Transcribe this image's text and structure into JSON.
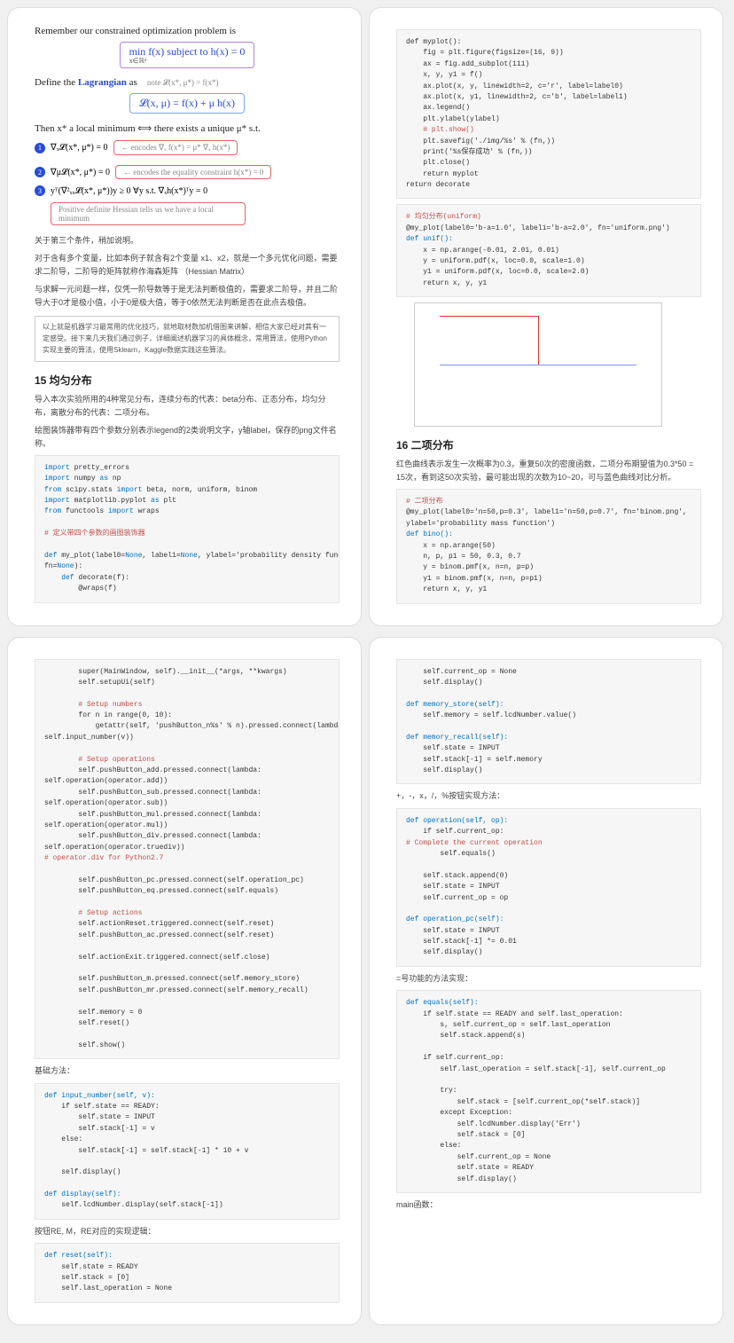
{
  "page1": {
    "intro": "Remember our constrained optimization problem is",
    "formula1": "min f(x)  subject to  h(x) = 0",
    "sub1": "x∈ℝᵈ",
    "def_line_a": "Define the ",
    "def_line_b": "Lagrangian",
    "def_line_c": " as",
    "def_note": "note  𝓛(x*, μ*) = f(x*)",
    "formula2": "𝓛(x, μ) = f(x) + μ h(x)",
    "then_a": "Then x* a local minimum  ⟺  there exists a unique μ* s.t.",
    "b1_eq": "∇ₓ𝓛(x*, μ*) = 0",
    "b1_box": "← encodes ∇ₓ f(x*) = μ* ∇ₓ h(x*)",
    "b2_eq": "∇μ𝓛(x*, μ*) = 0",
    "b2_box": "← encodes the equality constraint h(x*) = 0",
    "b3_eq": "yᵀ(∇²ₓₓ𝓛(x*, μ*))y ≥ 0   ∀y s.t. ∇ₓh(x*)ᵀy = 0",
    "b3_box": "Positive definite Hessian tells us we have a local minimum",
    "p_after1": "关于第三个条件，稍加说明。",
    "p_after2": "对于含有多个变量，比如本例子就含有2个变量 x1、x2，就是一个多元优化问题，需要求二阶导，二阶导的矩阵就称作海森矩阵 （Hessian Matrix）",
    "p_after3": "与求解一元问题一样，仅凭一阶导数等于是无法判断极值的，需要求二阶导，并且二阶导大于0才是极小值，小于0是极大值，等于0依然无法判断是否在此点去极值。",
    "bx1": "以上就是机器学习最常用的优化技巧，就地取材数加机借图来讲解，相信大家已经对其有一定感受。接下来几天我们通过例子，详细阐述机器学习的具体概念，常用算法，使用Python实现主要的算法，使用Sklearn，Kaggle数据实践这些算法。",
    "h15": "15 均匀分布",
    "p15a": "导入本次实验所用的4种常见分布，连续分布的代表：beta分布、正态分布，均匀分布，离散分布的代表：二项分布。",
    "p15b": "绘图装饰器带有四个参数分别表示legend的2类说明文字，y轴label，保存的png文件名称。",
    "code1": "import pretty_errors\nimport numpy as np\nfrom scipy.stats import beta, norm, uniform, binom\nimport matplotlib.pyplot as plt\nfrom functools import wraps\n\n# 定义带四个参数的画图装饰器\n\ndef my_plot(label0=None, label1=None, ylabel='probability density function',\nfn=None):\n    def decorate(f):\n        @wraps(f)"
  },
  "page2": {
    "code2_lines": [
      [
        "",
        "def myplot():"
      ],
      [
        "",
        "    fig = plt.figure(figsize=(16, 9))"
      ],
      [
        "",
        "    ax = fig.add_subplot(111)"
      ],
      [
        "",
        "    x, y, y1 = f()"
      ],
      [
        "",
        "    ax.plot(x, y, linewidth=2, c='r', label=label0)"
      ],
      [
        "",
        "    ax.plot(x, y1, linewidth=2, c='b', label=label1)"
      ],
      [
        "",
        "    ax.legend()"
      ],
      [
        "",
        "    plt.ylabel(ylabel)"
      ],
      [
        "cmt",
        "    # plt.show()"
      ],
      [
        "",
        "    plt.savefig('./img/%s' % (fn,))"
      ],
      [
        "",
        "    print('%s保存成功' % (fn,))"
      ],
      [
        "",
        "    plt.close()"
      ],
      [
        "",
        "    return myplot"
      ],
      [
        "",
        "return decorate"
      ]
    ],
    "code3_lines": [
      [
        "cmt",
        "# 均匀分布(uniform)"
      ],
      [
        "",
        "@my_plot(label0='b-a=1.0', label1='b-a=2.0', fn='uniform.png')"
      ],
      [
        "fdef",
        "def unif():"
      ],
      [
        "",
        "    x = np.arange(-0.01, 2.01, 0.01)"
      ],
      [
        "",
        "    y = uniform.pdf(x, loc=0.0, scale=1.0)"
      ],
      [
        "",
        "    y1 = uniform.pdf(x, loc=0.0, scale=2.0)"
      ],
      [
        "",
        "    return x, y, y1"
      ]
    ],
    "h16": "16 二项分布",
    "p16": "红色曲线表示发生一次概率为0.3，重复50次的密度函数，二项分布期望值为0.3*50 = 15次，看到这50次实验，最可能出现的次数为10~20，可与蓝色曲线对比分析。",
    "code4_lines": [
      [
        "cmt",
        "# 二项分布"
      ],
      [
        "",
        "@my_plot(label0='n=50,p=0.3', label1='n=50,p=0.7', fn='binom.png',"
      ],
      [
        "",
        "ylabel='probability mass function')"
      ],
      [
        "fdef",
        "def bino():"
      ],
      [
        "",
        "    x = np.arange(50)"
      ],
      [
        "",
        "    n, p, p1 = 50, 0.3, 0.7"
      ],
      [
        "",
        "    y = binom.pmf(x, n=n, p=p)"
      ],
      [
        "",
        "    y1 = binom.pmf(x, n=n, p=p1)"
      ],
      [
        "",
        "    return x, y, y1"
      ]
    ]
  },
  "page3": {
    "code5_lines": [
      [
        "",
        "        super(MainWindow, self).__init__(*args, **kwargs)"
      ],
      [
        "",
        "        self.setupUi(self)"
      ],
      [
        "",
        ""
      ],
      [
        "cmt",
        "        # Setup numbers"
      ],
      [
        "",
        "        for n in range(0, 10):"
      ],
      [
        "",
        "            getattr(self, 'pushButton_n%s' % n).pressed.connect(lambda v=n:"
      ],
      [
        "",
        "self.input_number(v))"
      ],
      [
        "",
        ""
      ],
      [
        "cmt",
        "        # Setup operations"
      ],
      [
        "",
        "        self.pushButton_add.pressed.connect(lambda:"
      ],
      [
        "",
        "self.operation(operator.add))"
      ],
      [
        "",
        "        self.pushButton_sub.pressed.connect(lambda:"
      ],
      [
        "",
        "self.operation(operator.sub))"
      ],
      [
        "",
        "        self.pushButton_mul.pressed.connect(lambda:"
      ],
      [
        "",
        "self.operation(operator.mul))"
      ],
      [
        "",
        "        self.pushButton_div.pressed.connect(lambda:"
      ],
      [
        "",
        "self.operation(operator.truediv))  "
      ],
      [
        "cmt",
        "# operator.div for Python2.7"
      ],
      [
        "",
        ""
      ],
      [
        "",
        "        self.pushButton_pc.pressed.connect(self.operation_pc)"
      ],
      [
        "",
        "        self.pushButton_eq.pressed.connect(self.equals)"
      ],
      [
        "",
        ""
      ],
      [
        "cmt",
        "        # Setup actions"
      ],
      [
        "",
        "        self.actionReset.triggered.connect(self.reset)"
      ],
      [
        "",
        "        self.pushButton_ac.pressed.connect(self.reset)"
      ],
      [
        "",
        ""
      ],
      [
        "",
        "        self.actionExit.triggered.connect(self.close)"
      ],
      [
        "",
        ""
      ],
      [
        "",
        "        self.pushButton_m.pressed.connect(self.memory_store)"
      ],
      [
        "",
        "        self.pushButton_mr.pressed.connect(self.memory_recall)"
      ],
      [
        "",
        ""
      ],
      [
        "",
        "        self.memory = 0"
      ],
      [
        "",
        "        self.reset()"
      ],
      [
        "",
        ""
      ],
      [
        "",
        "        self.show()"
      ]
    ],
    "p_basic": "基础方法：",
    "code6_lines": [
      [
        "fdef",
        "def input_number(self, v):"
      ],
      [
        "",
        "    if self.state == READY:"
      ],
      [
        "",
        "        self.state = INPUT"
      ],
      [
        "",
        "        self.stack[-1] = v"
      ],
      [
        "",
        "    else:"
      ],
      [
        "",
        "        self.stack[-1] = self.stack[-1] * 10 + v"
      ],
      [
        "",
        ""
      ],
      [
        "",
        "    self.display()"
      ],
      [
        "",
        ""
      ],
      [
        "fdef",
        "def display(self):"
      ],
      [
        "",
        "    self.lcdNumber.display(self.stack[-1])"
      ]
    ],
    "p_rem": "按钮RE, M，RE对应的实现逻辑：",
    "code7_lines": [
      [
        "fdef",
        "def reset(self):"
      ],
      [
        "",
        "    self.state = READY"
      ],
      [
        "",
        "    self.stack = [0]"
      ],
      [
        "",
        "    self.last_operation = None"
      ]
    ]
  },
  "page4": {
    "code8_lines": [
      [
        "",
        "    self.current_op = None"
      ],
      [
        "",
        "    self.display()"
      ],
      [
        "",
        ""
      ],
      [
        "fdef",
        "def memory_store(self):"
      ],
      [
        "",
        "    self.memory = self.lcdNumber.value()"
      ],
      [
        "",
        ""
      ],
      [
        "fdef",
        "def memory_recall(self):"
      ],
      [
        "",
        "    self.state = INPUT"
      ],
      [
        "",
        "    self.stack[-1] = self.memory"
      ],
      [
        "",
        "    self.display()"
      ]
    ],
    "p_ops": "+，-，x，/，%按钮实现方法：",
    "code9_lines": [
      [
        "fdef",
        "def operation(self, op):"
      ],
      [
        "",
        "    if self.current_op:  "
      ],
      [
        "cmt",
        "# Complete the current operation"
      ],
      [
        "",
        "        self.equals()"
      ],
      [
        "",
        ""
      ],
      [
        "",
        "    self.stack.append(0)"
      ],
      [
        "",
        "    self.state = INPUT"
      ],
      [
        "",
        "    self.current_op = op"
      ],
      [
        "",
        ""
      ],
      [
        "fdef",
        "def operation_pc(self):"
      ],
      [
        "",
        "    self.state = INPUT"
      ],
      [
        "",
        "    self.stack[-1] *= 0.01"
      ],
      [
        "",
        "    self.display()"
      ]
    ],
    "p_eq": "=号功能的方法实现：",
    "code10_lines": [
      [
        "fdef",
        "def equals(self):"
      ],
      [
        "",
        "    if self.state == READY and self.last_operation:"
      ],
      [
        "",
        "        s, self.current_op = self.last_operation"
      ],
      [
        "",
        "        self.stack.append(s)"
      ],
      [
        "",
        ""
      ],
      [
        "",
        "    if self.current_op:"
      ],
      [
        "",
        "        self.last_operation = self.stack[-1], self.current_op"
      ],
      [
        "",
        ""
      ],
      [
        "",
        "        try:"
      ],
      [
        "",
        "            self.stack = [self.current_op(*self.stack)]"
      ],
      [
        "",
        "        except Exception:"
      ],
      [
        "",
        "            self.lcdNumber.display('Err')"
      ],
      [
        "",
        "            self.stack = [0]"
      ],
      [
        "",
        "        else:"
      ],
      [
        "",
        "            self.current_op = None"
      ],
      [
        "",
        "            self.state = READY"
      ],
      [
        "",
        "            self.display()"
      ]
    ],
    "p_main": "main函数："
  }
}
